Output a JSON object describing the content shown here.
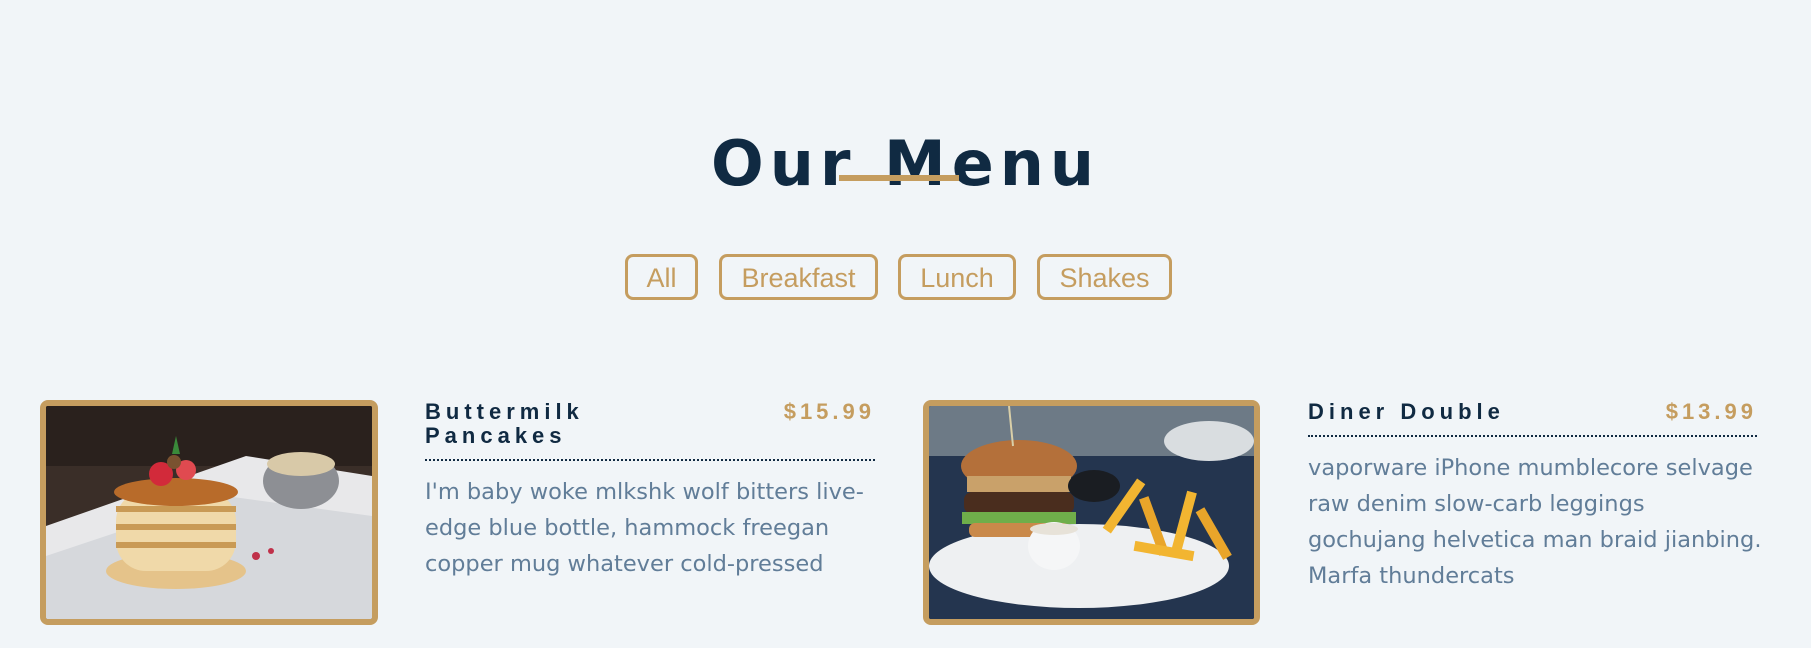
{
  "page": {
    "title": "Our Menu"
  },
  "filters": [
    {
      "label": "All"
    },
    {
      "label": "Breakfast"
    },
    {
      "label": "Lunch"
    },
    {
      "label": "Shakes"
    }
  ],
  "items": [
    {
      "name_line1": "Buttermilk",
      "name_line2": "Pancakes",
      "price": "$15.99",
      "description_lines": [
        "I'm baby woke mlkshk wolf bitters live-",
        "edge blue bottle, hammock freegan",
        "copper mug whatever cold-pressed"
      ],
      "image": "pancakes-photo"
    },
    {
      "name_line1": "Diner Double",
      "price": "$13.99",
      "description_lines": [
        "vaporware iPhone mumblecore selvage",
        "raw denim slow-carb leggings",
        "gochujang helvetica man braid jianbing.",
        "Marfa thundercats"
      ],
      "image": "burger-photo"
    }
  ],
  "colors": {
    "accent": "#c59d5f",
    "heading": "#102a42",
    "text": "#617d98",
    "background": "#f1f5f8"
  }
}
